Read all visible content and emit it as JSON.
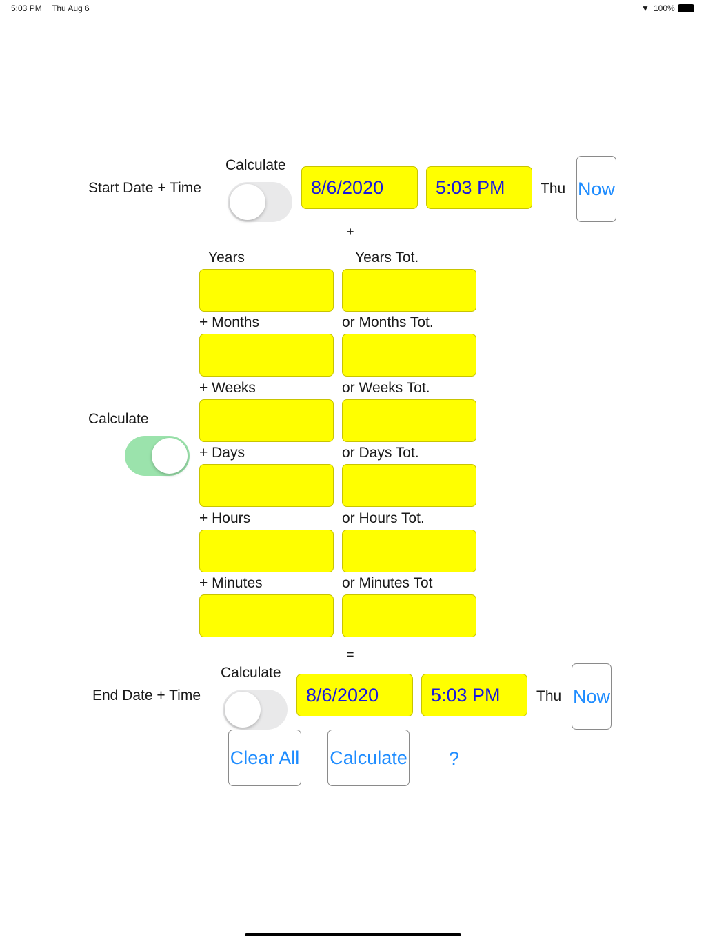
{
  "status_bar": {
    "time": "5:03 PM",
    "date": "Thu Aug 6",
    "battery": "100%"
  },
  "start": {
    "label": "Start Date + Time",
    "calc_label": "Calculate",
    "toggle_on": false,
    "date": "8/6/2020",
    "time": "5:03 PM",
    "weekday": "Thu",
    "now": "Now"
  },
  "plus": "+",
  "middle": {
    "calc_label": "Calculate",
    "toggle_on": true
  },
  "rows": [
    {
      "left": "Years",
      "right": "Years Tot.",
      "left_value": "",
      "right_value": ""
    },
    {
      "left": "+ Months",
      "right": "or Months Tot.",
      "left_value": "",
      "right_value": ""
    },
    {
      "left": "+ Weeks",
      "right": "or Weeks Tot.",
      "left_value": "",
      "right_value": ""
    },
    {
      "left": "+ Days",
      "right": "or Days Tot.",
      "left_value": "",
      "right_value": ""
    },
    {
      "left": "+ Hours",
      "right": "or Hours Tot.",
      "left_value": "",
      "right_value": ""
    },
    {
      "left": "+ Minutes",
      "right": "or Minutes Tot",
      "left_value": "",
      "right_value": ""
    }
  ],
  "equals": "=",
  "end": {
    "label": "End Date + Time",
    "calc_label": "Calculate",
    "toggle_on": false,
    "date": "8/6/2020",
    "time": "5:03 PM",
    "weekday": "Thu",
    "now": "Now"
  },
  "actions": {
    "clear": "Clear All",
    "calculate": "Calculate",
    "help": "?"
  }
}
